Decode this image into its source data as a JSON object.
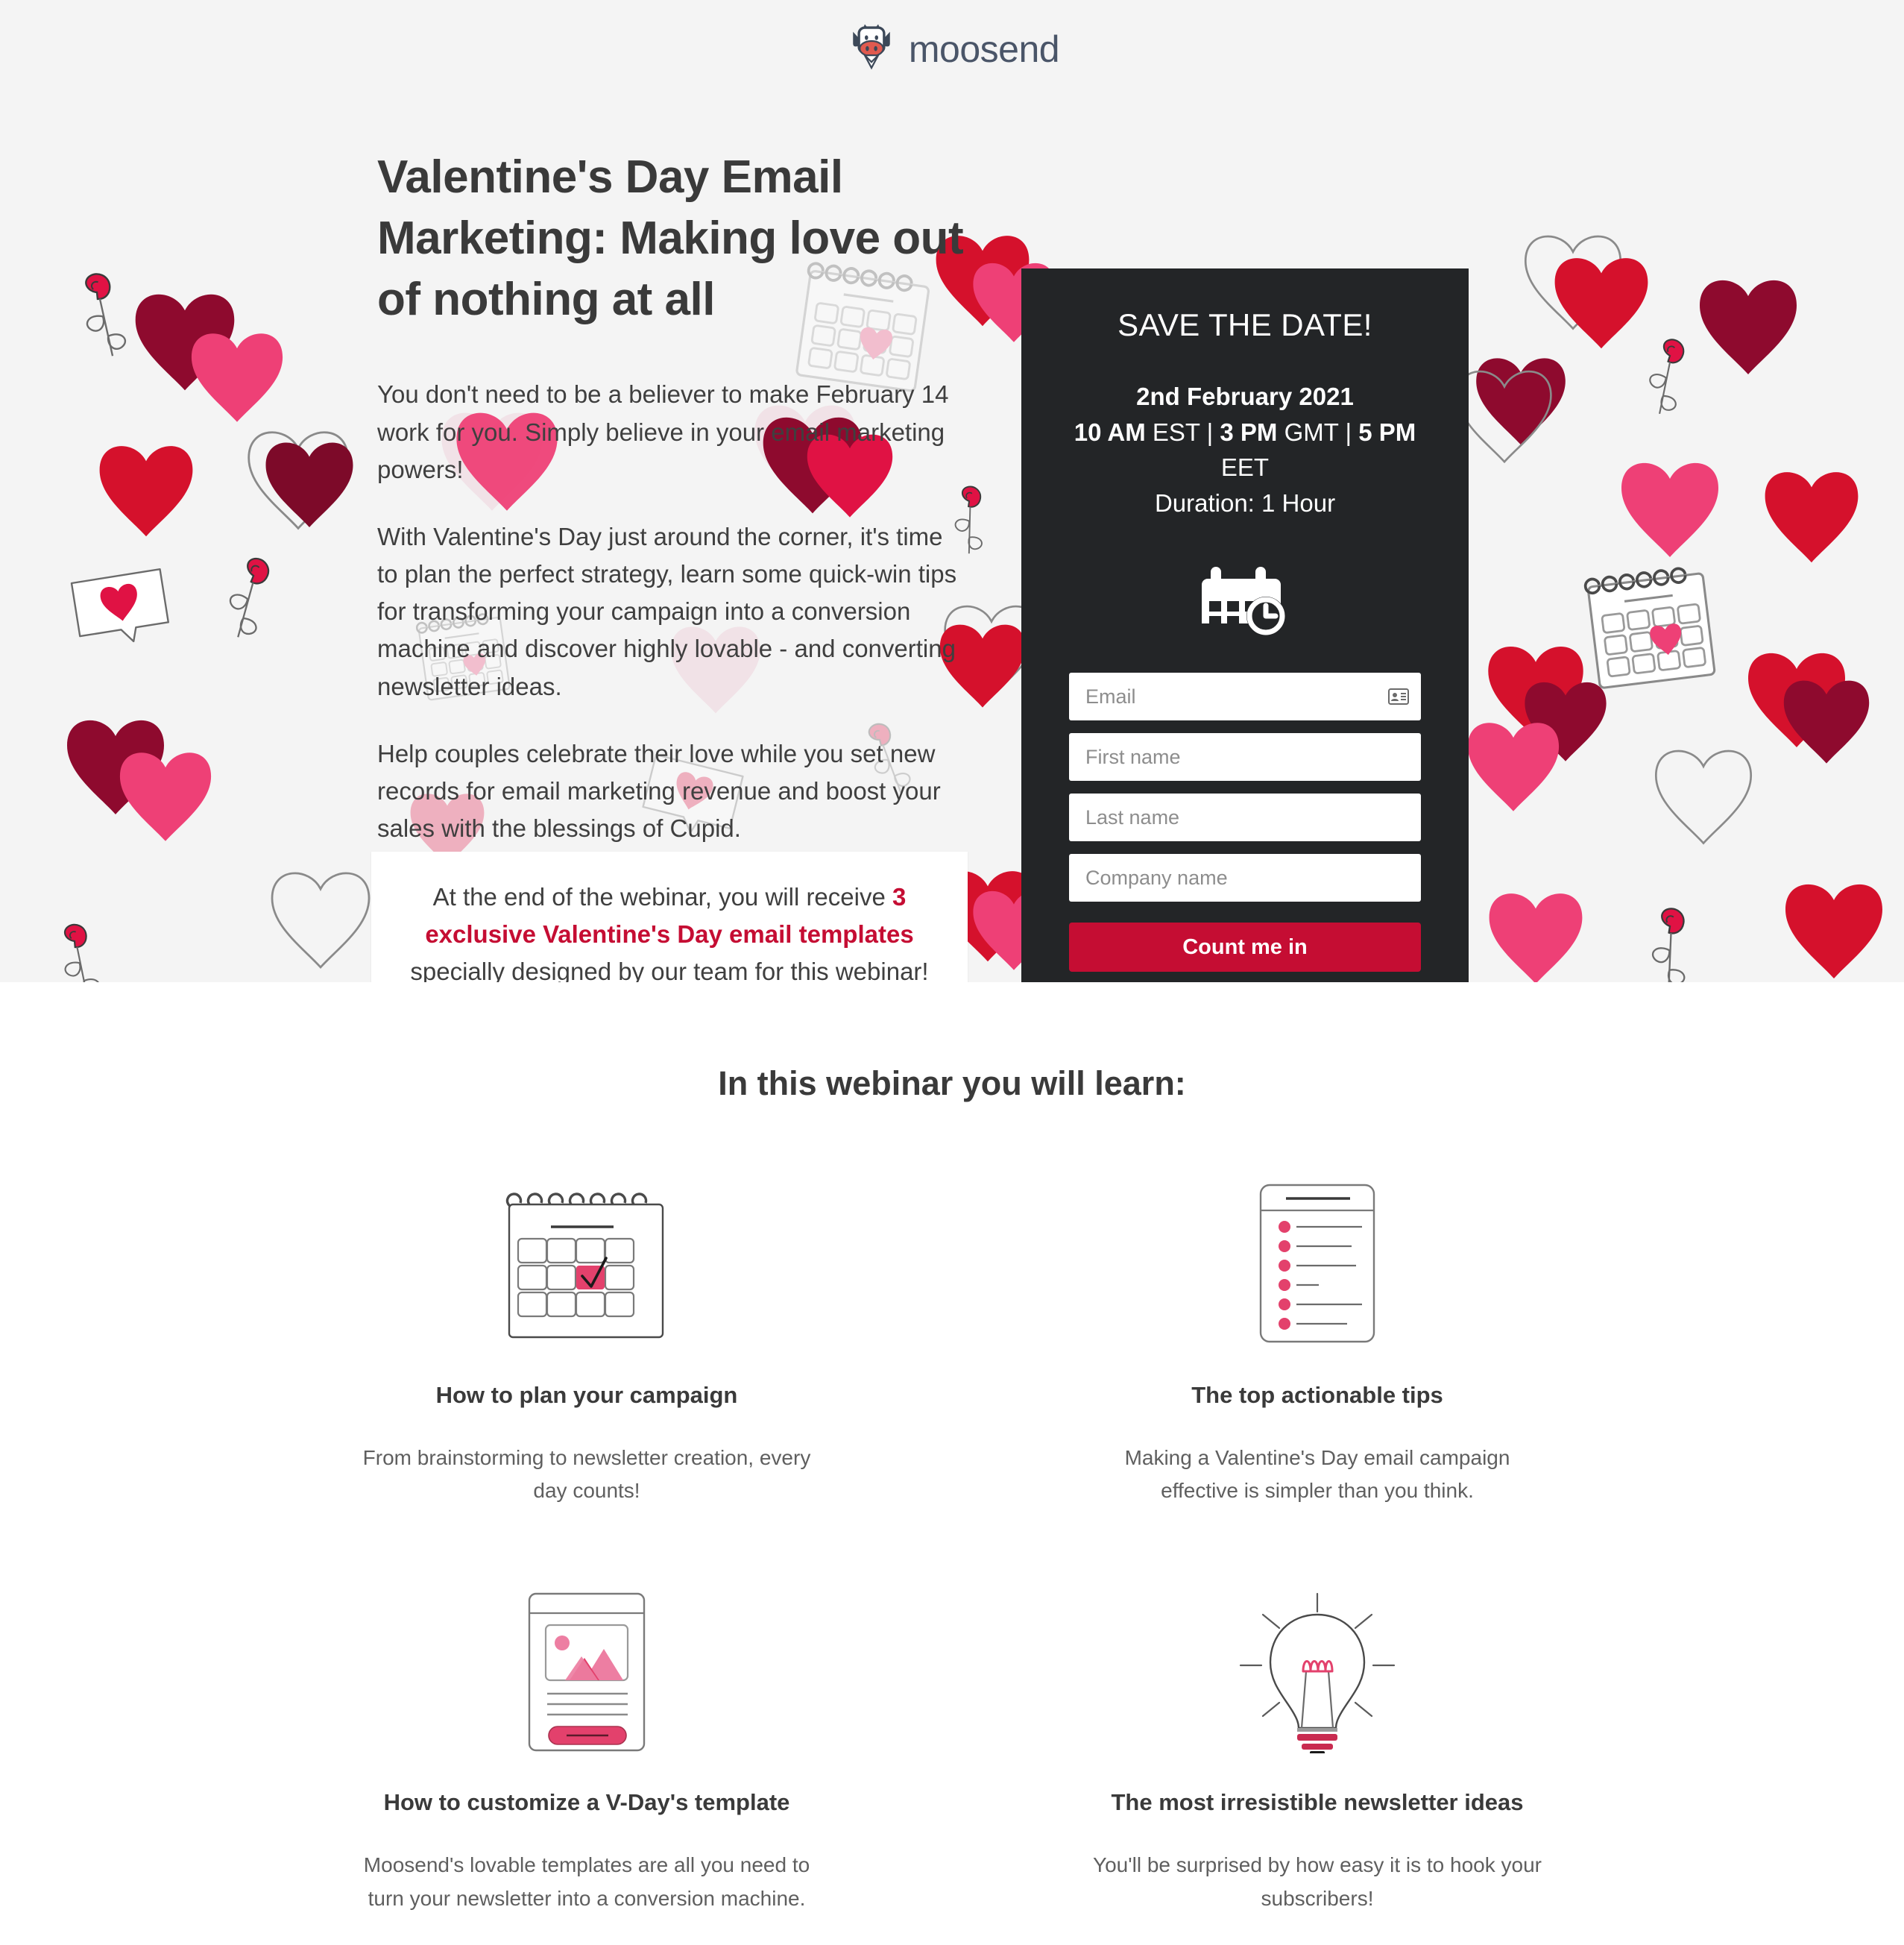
{
  "brand": {
    "logo_text": "moosend",
    "logo_icon": "cow-mascot-icon",
    "accent_red": "#C50D33",
    "accent_pink": "#EE4076",
    "dark_panel": "#232527",
    "hero_bg": "#f4f4f4"
  },
  "hero": {
    "title": "Valentine's Day Email Marketing: Making love out of nothing at all",
    "paragraphs": [
      "You don't need to be a believer to make February 14 work for you. Simply believe in your email marketing powers!",
      "With Valentine's Day just around the corner, it's time to plan the perfect strategy, learn some quick-win tips for transforming your campaign into a conversion machine and discover highly lovable - and converting newsletter ideas.",
      "Help couples celebrate their love while you set new records for email marketing revenue and boost your sales with the blessings of Cupid."
    ],
    "callout": {
      "lead": "At the end of the webinar, you will receive ",
      "highlight": "3 exclusive Valentine's Day email templates",
      "tail": " specially designed by our team for this webinar!"
    }
  },
  "form_panel": {
    "title": "SAVE THE DATE!",
    "date": "2nd February 2021",
    "time_parts": {
      "t1": "10 AM",
      "z1": " EST | ",
      "t2": "3 PM",
      "z2": " GMT | ",
      "t3": "5 PM",
      "z3": " EET"
    },
    "duration": "Duration: 1 Hour",
    "icon": "calendar-clock-icon",
    "fields": [
      {
        "name": "email",
        "placeholder": "Email",
        "value": "",
        "trailing_icon": "contact-card-icon"
      },
      {
        "name": "first-name",
        "placeholder": "First name",
        "value": ""
      },
      {
        "name": "last-name",
        "placeholder": "Last name",
        "value": ""
      },
      {
        "name": "company-name",
        "placeholder": "Company name",
        "value": ""
      }
    ],
    "submit_label": "Count me in"
  },
  "learn": {
    "heading": "In this webinar you will learn:",
    "cards": [
      {
        "icon": "calendar-check-icon",
        "heading": "How to plan your campaign",
        "text": "From brainstorming to newsletter creation, every day counts!"
      },
      {
        "icon": "checklist-icon",
        "heading": "The top actionable tips",
        "text": "Making a Valentine's Day email campaign effective is simpler than you think."
      },
      {
        "icon": "newsletter-template-icon",
        "heading": "How to customize a V-Day's template",
        "text": "Moosend's lovable templates are all you need to turn your newsletter into a conversion machine."
      },
      {
        "icon": "lightbulb-icon",
        "heading": "The most irresistible newsletter ideas",
        "text": "You'll be surprised by how easy it is to hook your subscribers!"
      }
    ]
  }
}
